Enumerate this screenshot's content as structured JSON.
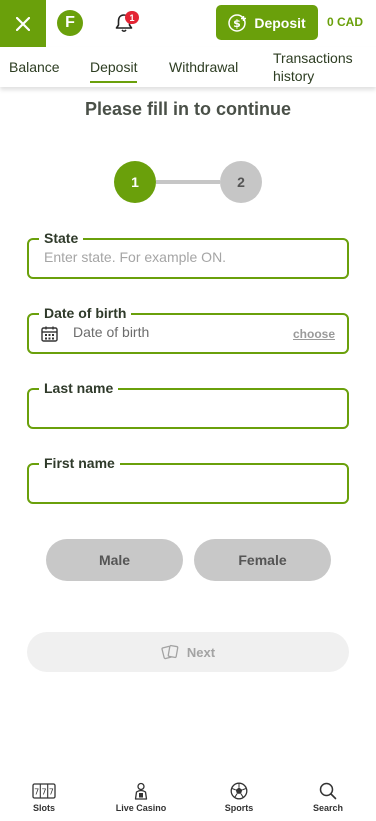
{
  "header": {
    "close_label": "✕",
    "brand_letter": "F",
    "notification_count": "1",
    "deposit_label": "Deposit",
    "balance": "0 CAD"
  },
  "tabs": [
    {
      "label": "Balance"
    },
    {
      "label": "Deposit",
      "active": true
    },
    {
      "label": "Withdrawal"
    },
    {
      "label": "Transactions history"
    }
  ],
  "form": {
    "title": "Please fill in to continue",
    "steps": [
      "1",
      "2"
    ],
    "current_step": 1,
    "state": {
      "label": "State",
      "placeholder": "Enter state. For example ON."
    },
    "dob": {
      "label": "Date of birth",
      "placeholder": "Date of birth",
      "choose_label": "choose"
    },
    "last_name": {
      "label": "Last name",
      "value": ""
    },
    "first_name": {
      "label": "First name",
      "value": ""
    },
    "gender": {
      "male_label": "Male",
      "female_label": "Female"
    },
    "next_label": "Next"
  },
  "bottom_nav": [
    {
      "label": "Slots",
      "icon": "slots-icon"
    },
    {
      "label": "Live Casino",
      "icon": "live-casino-icon"
    },
    {
      "label": "Sports",
      "icon": "sports-ball-icon"
    },
    {
      "label": "Search",
      "icon": "search-icon"
    }
  ],
  "colors": {
    "accent": "#6aa00b",
    "badge": "#e32434",
    "inactive": "#c6c6c6"
  }
}
